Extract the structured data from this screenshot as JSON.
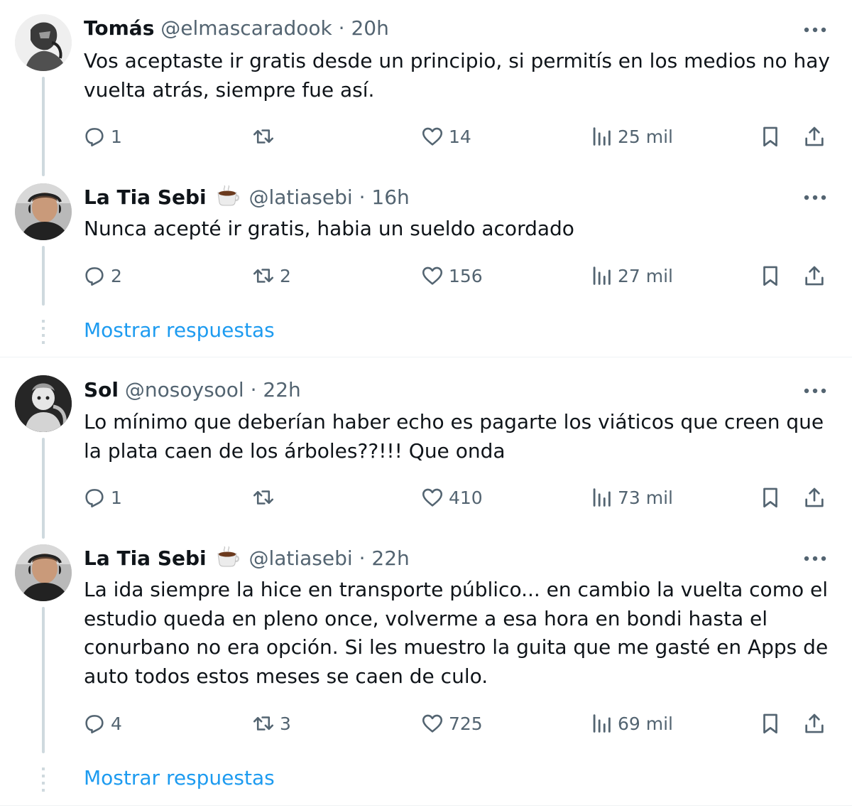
{
  "sep": "·",
  "tweets": [
    {
      "name": "Tomás",
      "handle": "@elmascaradook",
      "time": "20h",
      "text_lines": [
        "Vos aceptaste ir gratis desde un principio, si permitís en los medios no hay",
        "vuelta atrás, siempre fue así."
      ],
      "replies": "1",
      "retweets": "",
      "likes": "14",
      "views": "25 mil"
    },
    {
      "name": "La Tia Sebi",
      "emoji": "coffee-cup-icon",
      "handle": "@latiasebi",
      "time": "16h",
      "text_lines": [
        "Nunca acepté ir gratis, habia un sueldo acordado"
      ],
      "replies": "2",
      "retweets": "2",
      "likes": "156",
      "views": "27 mil"
    },
    {
      "name": "Sol",
      "handle": "@nosoysool",
      "time": "22h",
      "text_lines": [
        "Lo mínimo que deberían haber echo es pagarte los viáticos que creen que",
        "la plata caen de los árboles??!!! Que onda"
      ],
      "replies": "1",
      "retweets": "",
      "likes": "410",
      "views": "73 mil"
    },
    {
      "name": "La Tia Sebi",
      "emoji": "coffee-cup-icon",
      "handle": "@latiasebi",
      "time": "22h",
      "text_lines": [
        "La ida siempre la hice en transporte público... en cambio la vuelta como el",
        "estudio queda en pleno once, volverme a esa hora en bondi hasta el",
        "conurbano no era opción. Si les muestro la guita que me gasté en Apps de",
        "auto todos estos meses se caen de culo."
      ],
      "replies": "4",
      "retweets": "3",
      "likes": "725",
      "views": "69 mil"
    }
  ],
  "show_replies_label": "Mostrar respuestas",
  "colors": {
    "text": "#0f1419",
    "secondary": "#536471",
    "link": "#1d9bf0",
    "thread_line": "#cfd9de",
    "divider": "#eff3f4"
  }
}
